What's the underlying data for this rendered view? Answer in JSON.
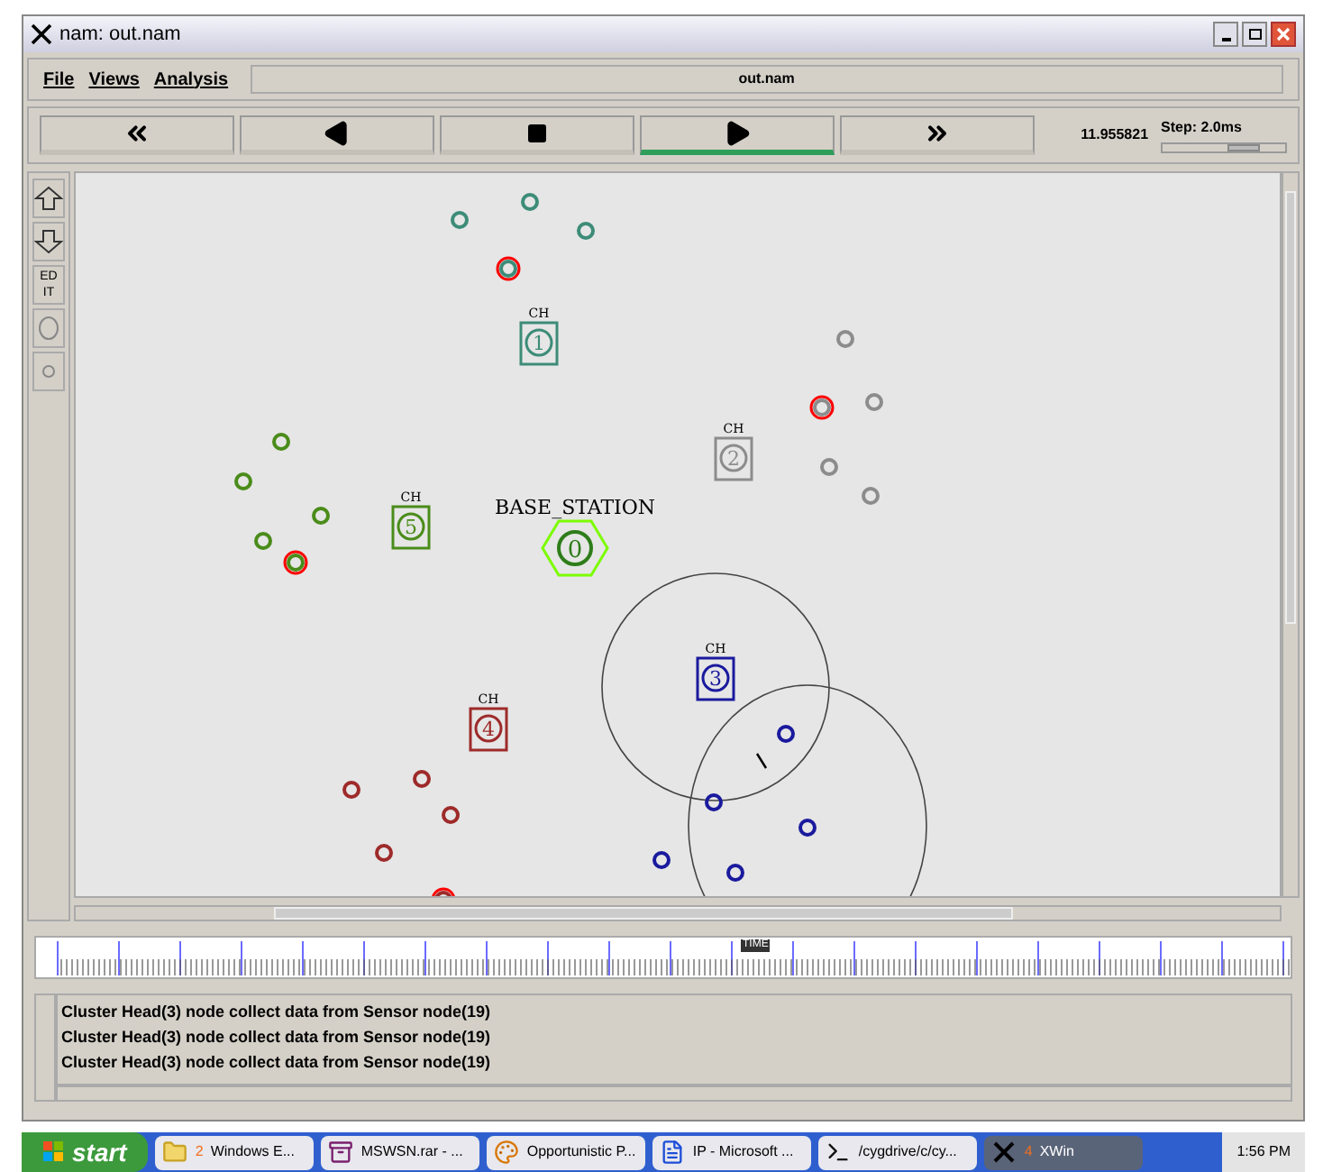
{
  "window": {
    "title": "nam: out.nam"
  },
  "menu": [
    {
      "label": "File"
    },
    {
      "label": "Views"
    },
    {
      "label": "Analysis"
    }
  ],
  "file_label": "out.nam",
  "transport": [
    {
      "kind": "rewind",
      "selected": false
    },
    {
      "kind": "back",
      "selected": false
    },
    {
      "kind": "stop",
      "selected": false
    },
    {
      "kind": "play",
      "selected": true
    },
    {
      "kind": "forward",
      "selected": false
    }
  ],
  "time": "11.955821",
  "step": {
    "label": "Step: 2.0ms",
    "level": 0.7
  },
  "tools": [
    {
      "kind": "zoom-in"
    },
    {
      "kind": "zoom-out"
    },
    {
      "kind": "edit",
      "label": "ED IT"
    },
    {
      "kind": "big-circle"
    },
    {
      "kind": "small-circle"
    }
  ],
  "base_station": {
    "label": "BASE_STATION",
    "number": "0"
  },
  "clusters": [
    {
      "head": {
        "label": "CH",
        "number": "1"
      },
      "color": "#3d8c78",
      "sensors": [
        {
          "alert": false
        },
        {
          "alert": false
        },
        {
          "alert": false
        },
        {
          "alert": true
        }
      ]
    },
    {
      "head": {
        "label": "CH",
        "number": "2"
      },
      "color": "#8c8c8c",
      "sensors": [
        {
          "alert": false
        },
        {
          "alert": true
        },
        {
          "alert": false
        },
        {
          "alert": false
        },
        {
          "alert": false
        }
      ]
    },
    {
      "head": {
        "label": "CH",
        "number": "3"
      },
      "color": "#1a1a9e",
      "sensors": [
        {
          "alert": false
        },
        {
          "alert": false
        },
        {
          "alert": false
        },
        {
          "alert": false
        },
        {
          "alert": false
        }
      ]
    },
    {
      "head": {
        "label": "CH",
        "number": "4"
      },
      "color": "#9e2a2a",
      "sensors": [
        {
          "alert": false
        },
        {
          "alert": false
        },
        {
          "alert": false
        },
        {
          "alert": false
        },
        {
          "alert": true
        }
      ]
    },
    {
      "head": {
        "label": "CH",
        "number": "5"
      },
      "color": "#4a8c1a",
      "sensors": [
        {
          "alert": false
        },
        {
          "alert": false
        },
        {
          "alert": false
        },
        {
          "alert": false
        },
        {
          "alert": true
        }
      ]
    }
  ],
  "timeline_label": "TIME",
  "log": [
    "Cluster Head(3) node collect data from Sensor node(19)",
    "Cluster Head(3) node collect data from Sensor node(19)",
    "Cluster Head(3) node collect data from Sensor node(19)"
  ],
  "taskbar": {
    "start": "start",
    "tasks": [
      {
        "kind": "folder",
        "count": "2",
        "label": "Windows E...",
        "selected": false
      },
      {
        "kind": "archive",
        "label": "MSWSN.rar - ...",
        "selected": false
      },
      {
        "kind": "paint",
        "label": "Opportunistic P...",
        "selected": false
      },
      {
        "kind": "word",
        "label": "IP - Microsoft ...",
        "selected": false
      },
      {
        "kind": "terminal",
        "label": "/cygdrive/c/cy...",
        "selected": false
      },
      {
        "kind": "x",
        "count": "4",
        "label": "XWin",
        "selected": true
      }
    ],
    "clock": "1:56 PM"
  }
}
